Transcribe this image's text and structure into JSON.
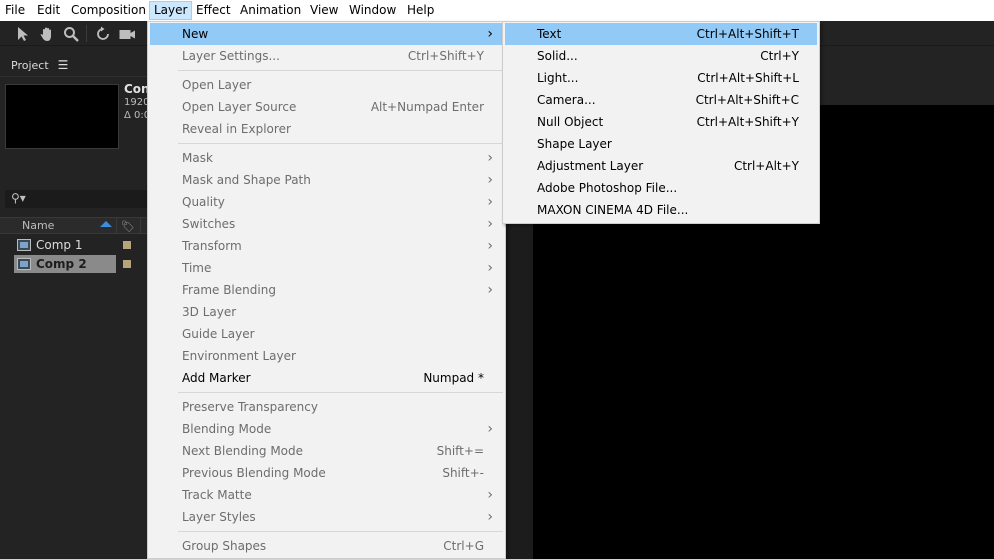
{
  "menubar": {
    "items": [
      "File",
      "Edit",
      "Composition",
      "Layer",
      "Effect",
      "Animation",
      "View",
      "Window",
      "Help"
    ],
    "open_item": "Layer"
  },
  "toolbar": {
    "tools": [
      "selection-tool-icon",
      "hand-tool-icon",
      "zoom-tool-icon",
      "rotate-tool-icon",
      "camera-tool-icon"
    ]
  },
  "project_panel": {
    "title": "Project",
    "thumb_info": {
      "name": "Con",
      "line1": "1920",
      "line2": "Δ 0:0"
    },
    "search_placeholder": "",
    "columns": {
      "name": "Name"
    },
    "items": [
      {
        "name": "Comp 1",
        "selected": false,
        "label_color": "#b7a57a"
      },
      {
        "name": "Comp 2",
        "selected": true,
        "label_color": "#b7a57a"
      }
    ]
  },
  "layer_menu": {
    "items": [
      {
        "label": "New",
        "shortcut": "",
        "submenu": true,
        "enabled": true,
        "highlighted": true
      },
      {
        "label": "Layer Settings...",
        "shortcut": "Ctrl+Shift+Y",
        "submenu": false,
        "enabled": false
      },
      {
        "separator": true
      },
      {
        "label": "Open Layer",
        "shortcut": "",
        "submenu": false,
        "enabled": false
      },
      {
        "label": "Open Layer Source",
        "shortcut": "Alt+Numpad Enter",
        "submenu": false,
        "enabled": false
      },
      {
        "label": "Reveal in Explorer",
        "shortcut": "",
        "submenu": false,
        "enabled": false
      },
      {
        "separator": true
      },
      {
        "label": "Mask",
        "shortcut": "",
        "submenu": true,
        "enabled": false
      },
      {
        "label": "Mask and Shape Path",
        "shortcut": "",
        "submenu": true,
        "enabled": false
      },
      {
        "label": "Quality",
        "shortcut": "",
        "submenu": true,
        "enabled": false
      },
      {
        "label": "Switches",
        "shortcut": "",
        "submenu": true,
        "enabled": false
      },
      {
        "label": "Transform",
        "shortcut": "",
        "submenu": true,
        "enabled": false
      },
      {
        "label": "Time",
        "shortcut": "",
        "submenu": true,
        "enabled": false
      },
      {
        "label": "Frame Blending",
        "shortcut": "",
        "submenu": true,
        "enabled": false
      },
      {
        "label": "3D Layer",
        "shortcut": "",
        "submenu": false,
        "enabled": false
      },
      {
        "label": "Guide Layer",
        "shortcut": "",
        "submenu": false,
        "enabled": false
      },
      {
        "label": "Environment Layer",
        "shortcut": "",
        "submenu": false,
        "enabled": false
      },
      {
        "label": "Add Marker",
        "shortcut": "Numpad *",
        "submenu": false,
        "enabled": true
      },
      {
        "separator": true
      },
      {
        "label": "Preserve Transparency",
        "shortcut": "",
        "submenu": false,
        "enabled": false
      },
      {
        "label": "Blending Mode",
        "shortcut": "",
        "submenu": true,
        "enabled": false
      },
      {
        "label": "Next Blending Mode",
        "shortcut": "Shift+=",
        "submenu": false,
        "enabled": false
      },
      {
        "label": "Previous Blending Mode",
        "shortcut": "Shift+-",
        "submenu": false,
        "enabled": false
      },
      {
        "label": "Track Matte",
        "shortcut": "",
        "submenu": true,
        "enabled": false
      },
      {
        "label": "Layer Styles",
        "shortcut": "",
        "submenu": true,
        "enabled": false
      },
      {
        "separator": true
      },
      {
        "label": "Group Shapes",
        "shortcut": "Ctrl+G",
        "submenu": false,
        "enabled": false
      }
    ]
  },
  "new_submenu": {
    "items": [
      {
        "label": "Text",
        "shortcut": "Ctrl+Alt+Shift+T",
        "highlighted": true
      },
      {
        "label": "Solid...",
        "shortcut": "Ctrl+Y"
      },
      {
        "label": "Light...",
        "shortcut": "Ctrl+Alt+Shift+L"
      },
      {
        "label": "Camera...",
        "shortcut": "Ctrl+Alt+Shift+C"
      },
      {
        "label": "Null Object",
        "shortcut": "Ctrl+Alt+Shift+Y"
      },
      {
        "label": "Shape Layer",
        "shortcut": ""
      },
      {
        "label": "Adjustment Layer",
        "shortcut": "Ctrl+Alt+Y"
      },
      {
        "label": "Adobe Photoshop File...",
        "shortcut": ""
      },
      {
        "label": "MAXON CINEMA 4D File...",
        "shortcut": ""
      }
    ]
  },
  "colors": {
    "menu_highlight": "#91c9f7",
    "menu_background": "#f2f2f2",
    "app_background": "#232323",
    "viewer_background": "#000000"
  }
}
